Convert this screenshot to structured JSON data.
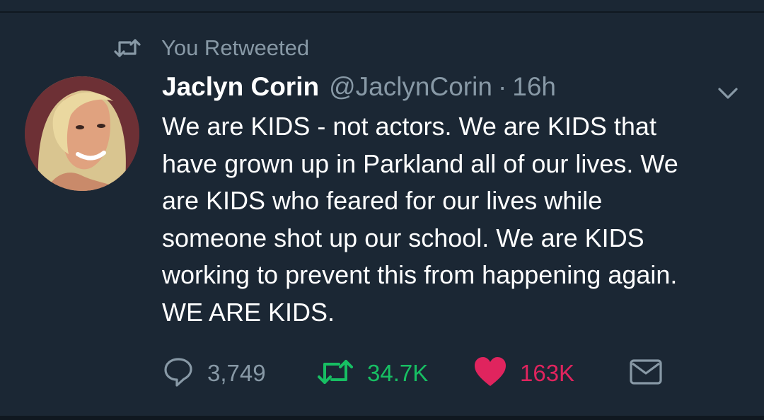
{
  "context": {
    "label": "You Retweeted",
    "icon": "retweet-icon"
  },
  "tweet": {
    "author_name": "Jaclyn Corin",
    "handle": "@JaclynCorin",
    "separator": "·",
    "time": "16h",
    "text": "We are KIDS - not actors. We are KIDS that\nhave grown up in Parkland all of our lives. We\nare KIDS who feared for our lives while\nsomeone shot up our school. We are KIDS\nworking to prevent this from happening again.\nWE ARE KIDS."
  },
  "actions": {
    "reply_count": "3,749",
    "retweet_count": "34.7K",
    "like_count": "163K"
  },
  "colors": {
    "background": "#1b2734",
    "secondary_text": "#8899a6",
    "retweet_green": "#17bf63",
    "like_red": "#e0245e"
  }
}
